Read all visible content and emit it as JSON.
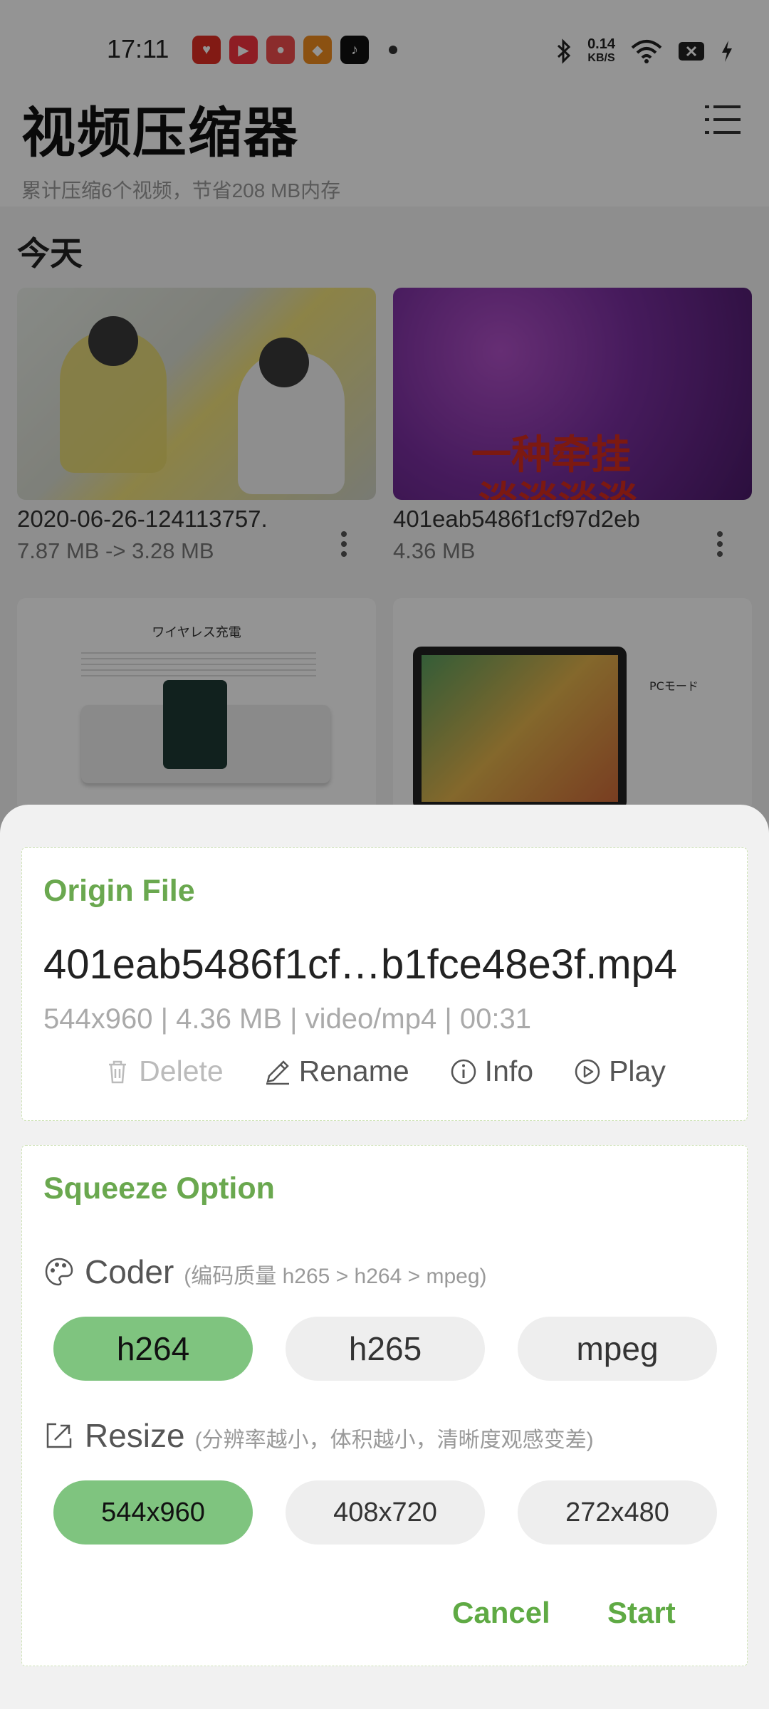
{
  "status_bar": {
    "time": "17:11",
    "net_speed_value": "0.14",
    "net_speed_unit": "KB/S",
    "app_icons": [
      "pinduoduo-icon",
      "toutiao-icon",
      "alipay-icon",
      "uc-browser-icon",
      "douyin-icon"
    ]
  },
  "header": {
    "title": "视频压缩器",
    "subtitle": "累计压缩6个视频，节省208 MB内存"
  },
  "section": {
    "label": "今天"
  },
  "videos": [
    {
      "name": "2020-06-26-124113757.",
      "size": "7.87 MB -> 3.28 MB"
    },
    {
      "name": "401eab5486f1cf97d2eb",
      "size": "4.36 MB",
      "overlay_text_1": "一种牵挂",
      "overlay_text_2": "淡淡淡淡"
    },
    {
      "name": "",
      "size": "",
      "doc_title": "ワイヤレス充電"
    },
    {
      "name": "",
      "size": "",
      "doc_title": "PCモード"
    }
  ],
  "sheet": {
    "origin": {
      "heading": "Origin File",
      "file_name": "401eab5486f1cf…b1fce48e3f.mp4",
      "meta": "544x960 | 4.36 MB | video/mp4 | 00:31",
      "actions": {
        "delete": "Delete",
        "rename": "Rename",
        "info": "Info",
        "play": "Play"
      }
    },
    "squeeze": {
      "heading": "Squeeze Option",
      "coder": {
        "label": "Coder",
        "hint": "(编码质量 h265 > h264 > mpeg)",
        "options": [
          "h264",
          "h265",
          "mpeg"
        ],
        "selected": "h264"
      },
      "resize": {
        "label": "Resize",
        "hint": "(分辨率越小，体积越小，清晰度观感变差)",
        "options": [
          "544x960",
          "408x720",
          "272x480"
        ],
        "selected": "544x960"
      },
      "cancel_label": "Cancel",
      "start_label": "Start"
    }
  },
  "colors": {
    "accent": "#6aa84f",
    "chip_selected": "#7fc47f",
    "chip": "#eeeeee",
    "scrim": "rgba(0,0,0,0.42)"
  }
}
